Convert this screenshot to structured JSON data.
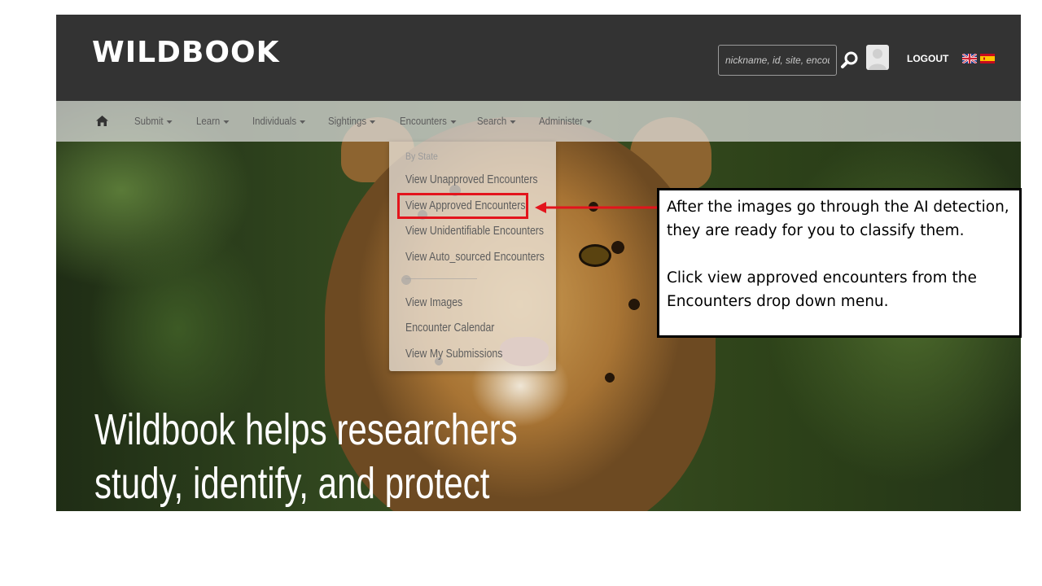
{
  "header": {
    "logo_text": "WILDBOOK",
    "search": {
      "placeholder": "nickname, id, site, encou",
      "value": ""
    },
    "logout_label": "LOGOUT",
    "languages": [
      "uk-flag",
      "es-flag"
    ]
  },
  "nav": {
    "items": [
      {
        "label": "Submit"
      },
      {
        "label": "Learn"
      },
      {
        "label": "Individuals"
      },
      {
        "label": "Sightings"
      },
      {
        "label": "Encounters"
      },
      {
        "label": "Search"
      },
      {
        "label": "Administer"
      }
    ]
  },
  "dropdown": {
    "header": "By State",
    "items": [
      "View Unapproved Encounters",
      "View Approved Encounters",
      "View Unidentifiable Encounters",
      "View Auto_sourced Encounters",
      "View Images",
      "Encounter Calendar",
      "View My Submissions"
    ],
    "highlighted": "View Approved Encounters"
  },
  "hero": {
    "line1": "Wildbook helps researchers",
    "line2": "study, identify, and protect"
  },
  "callout": {
    "paragraph1": "After the images go through the AI detection, they are ready for you to classify them.",
    "paragraph2": "Click view approved encounters from the Encounters drop down menu."
  },
  "colors": {
    "topbar": "#333333",
    "highlight": "#e3141c",
    "nav_text": "#5d5d5d"
  },
  "icons": [
    "home-icon",
    "search-icon",
    "avatar",
    "uk-flag",
    "es-flag",
    "caret-down-icon",
    "arrow-left-icon"
  ]
}
